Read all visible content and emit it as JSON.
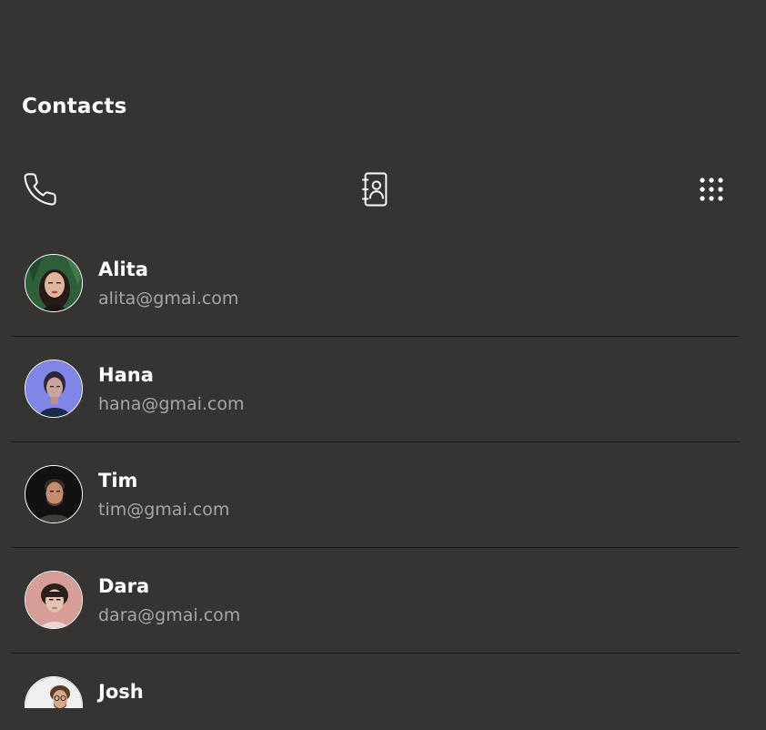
{
  "header": {
    "title": "Contacts"
  },
  "tabs": [
    {
      "icon": "phone-icon"
    },
    {
      "icon": "contact-book-icon"
    },
    {
      "icon": "dialpad-icon"
    }
  ],
  "colors": {
    "background": "#353433",
    "text_primary": "#ffffff",
    "text_secondary": "#a8a6a3",
    "divider": "#1e1d1c"
  },
  "contacts": [
    {
      "name": "Alita",
      "email": "alita@gmai.com"
    },
    {
      "name": "Hana",
      "email": "hana@gmai.com"
    },
    {
      "name": "Tim",
      "email": "tim@gmai.com"
    },
    {
      "name": "Dara",
      "email": "dara@gmai.com"
    },
    {
      "name": "Josh",
      "email": ""
    }
  ]
}
